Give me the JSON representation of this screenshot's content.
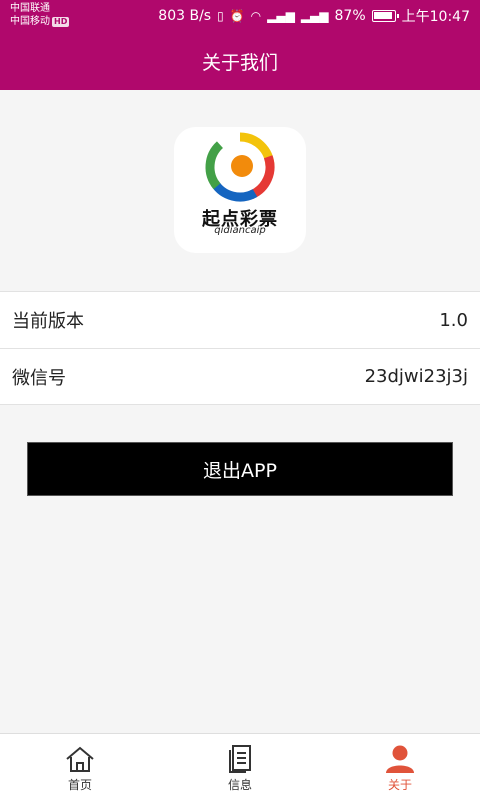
{
  "status_bar": {
    "carrier1": "中国联通",
    "carrier2": "中国移动",
    "hd": "HD",
    "speed": "803 B/s",
    "battery": "87%",
    "time": "上午10:47"
  },
  "header": {
    "title": "关于我们"
  },
  "logo": {
    "text": "起点彩票",
    "subtext": "qidiancaip"
  },
  "info": {
    "rows": [
      {
        "label": "当前版本",
        "value": "1.0"
      },
      {
        "label": "微信号",
        "value": "23djwi23j3j"
      }
    ]
  },
  "actions": {
    "exit_label": "退出APP"
  },
  "bottom_nav": {
    "items": [
      {
        "label": "首页",
        "icon": "home-icon"
      },
      {
        "label": "信息",
        "icon": "document-icon"
      },
      {
        "label": "关于",
        "icon": "user-icon"
      }
    ],
    "active_color": "#e0533a"
  },
  "colors": {
    "brand": "#b0086c",
    "button": "#000000"
  }
}
